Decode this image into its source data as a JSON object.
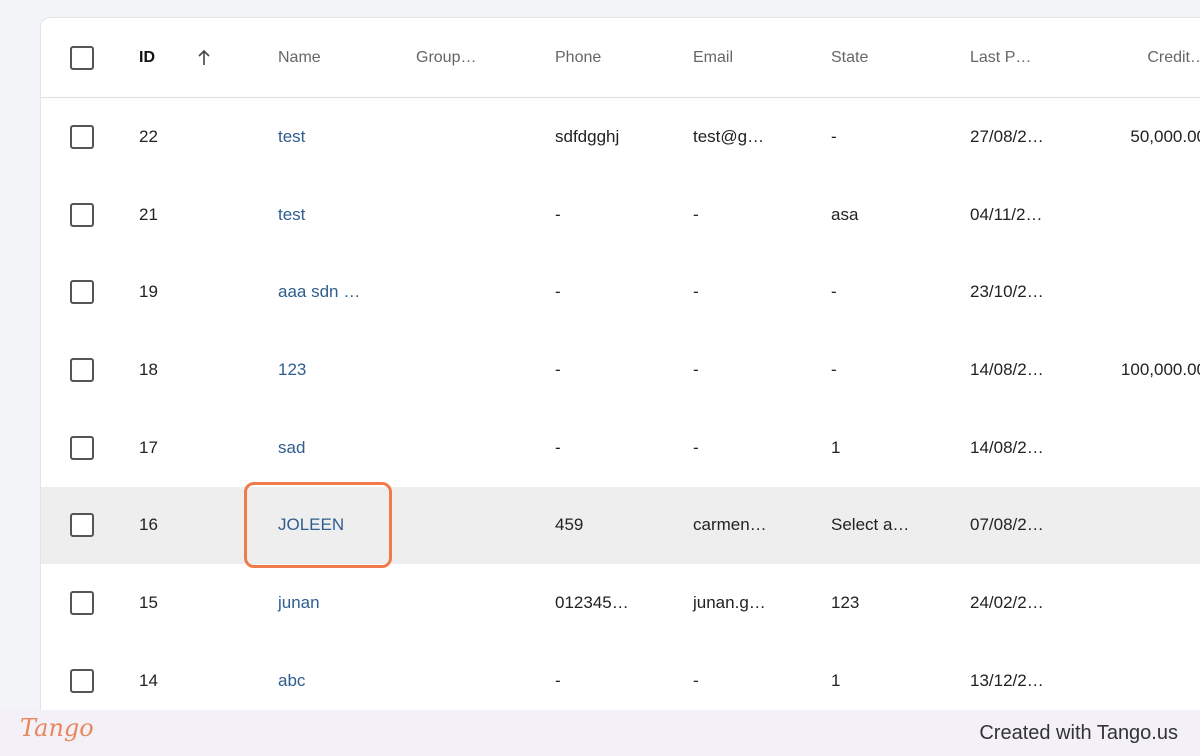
{
  "table": {
    "headers": {
      "id": "ID",
      "name": "Name",
      "group": "Group…",
      "phone": "Phone",
      "email": "Email",
      "state": "State",
      "last_p": "Last P…",
      "credit": "Credit…"
    },
    "rows": [
      {
        "id": "22",
        "name": "test",
        "group": "",
        "phone": "sdfdgghj",
        "email": "test@g…",
        "state": "-",
        "last_p": "27/08/2…",
        "credit": "50,000.00"
      },
      {
        "id": "21",
        "name": "test",
        "group": "",
        "phone": "-",
        "email": "-",
        "state": "asa",
        "last_p": "04/11/2…",
        "credit": "-"
      },
      {
        "id": "19",
        "name": "aaa sdn …",
        "group": "",
        "phone": "-",
        "email": "-",
        "state": "-",
        "last_p": "23/10/2…",
        "credit": "-"
      },
      {
        "id": "18",
        "name": "123",
        "group": "",
        "phone": "-",
        "email": "-",
        "state": "-",
        "last_p": "14/08/2…",
        "credit": "100,000.00"
      },
      {
        "id": "17",
        "name": "sad",
        "group": "",
        "phone": "-",
        "email": "-",
        "state": "1",
        "last_p": "14/08/2…",
        "credit": "-"
      },
      {
        "id": "16",
        "name": "JOLEEN",
        "group": "",
        "phone": "459",
        "email": "carmen…",
        "state": "Select a…",
        "last_p": "07/08/2…",
        "credit": "-"
      },
      {
        "id": "15",
        "name": "junan",
        "group": "",
        "phone": "012345…",
        "email": "junan.g…",
        "state": "123",
        "last_p": "24/02/2…",
        "credit": "-"
      },
      {
        "id": "14",
        "name": "abc",
        "group": "",
        "phone": "-",
        "email": "-",
        "state": "1",
        "last_p": "13/12/2…",
        "credit": "-"
      }
    ],
    "selected_row_index": 5
  },
  "footer": {
    "logo": "Tango",
    "text": "Created with Tango.us"
  },
  "colors": {
    "link": "#2f5d8f",
    "highlight": "#f07b4a",
    "selected_row": "#eeeeee"
  }
}
